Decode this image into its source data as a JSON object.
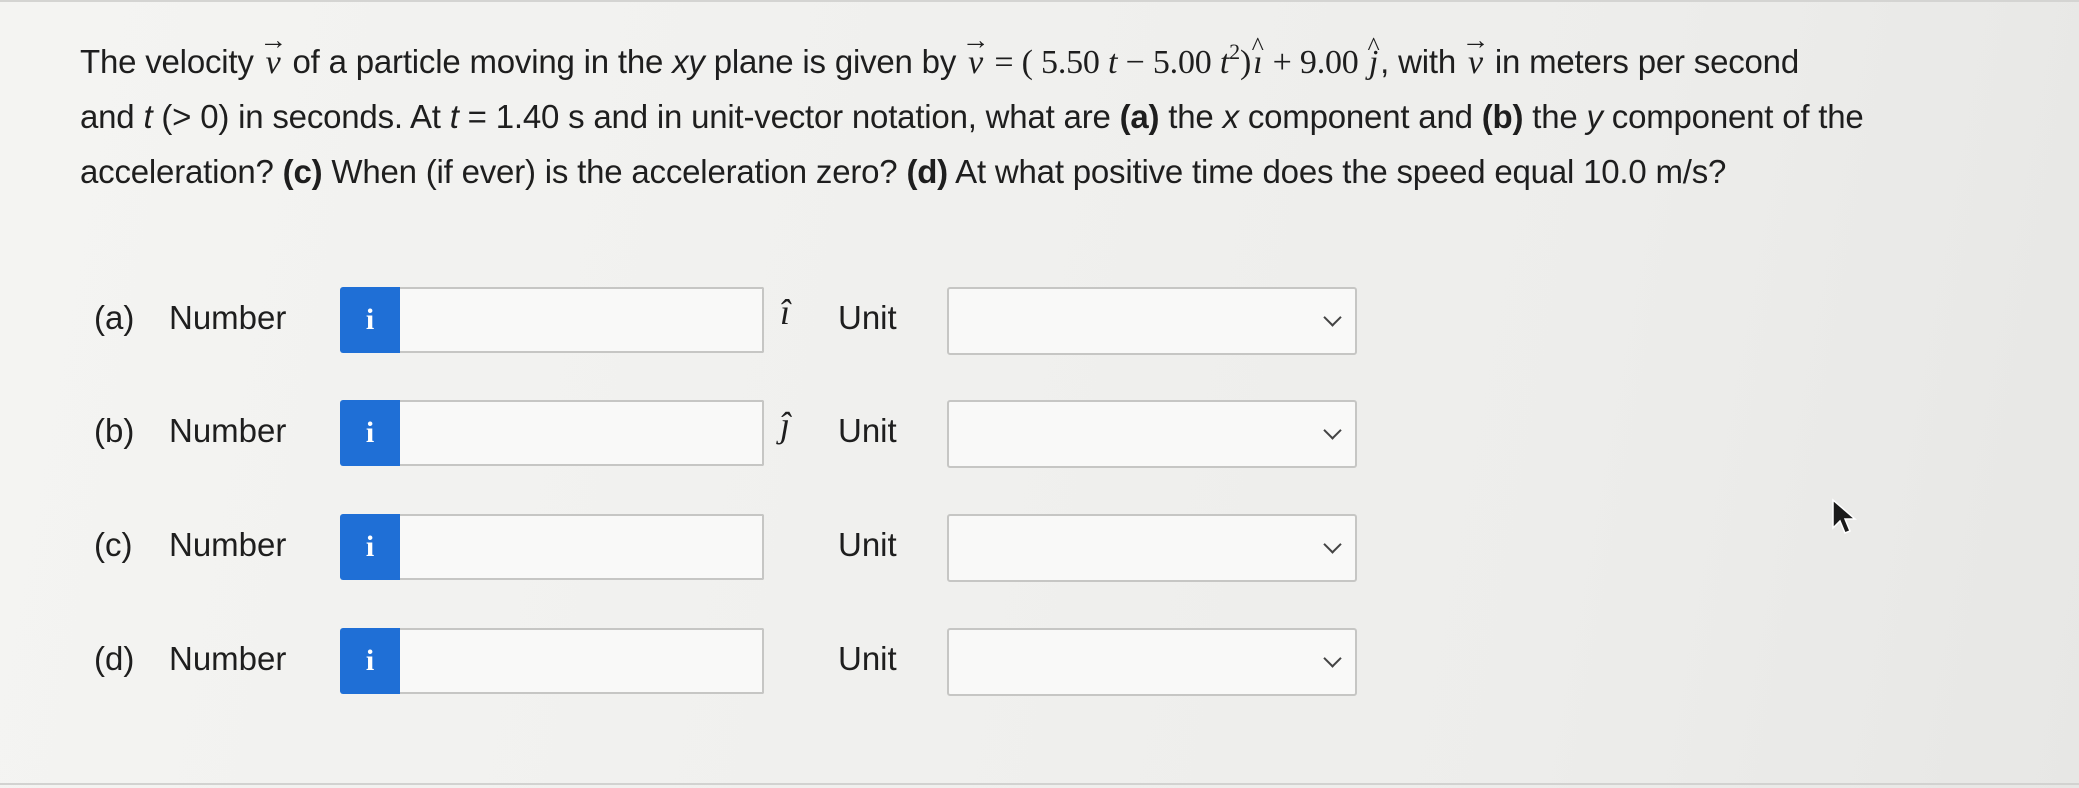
{
  "question": {
    "l1_a": "The velocity ",
    "l1_b": " of a particle moving in the ",
    "l1_xy": "xy",
    "l1_c": " plane is given by ",
    "eq_eq": " = ( ",
    "eq_c1": "5.50",
    "eq_t1": "t",
    "eq_minus": " − ",
    "eq_c2": "5.00",
    "eq_t2": "t",
    "eq_exp": "2",
    "eq_close": ")",
    "eq_plus": " + ",
    "eq_c3": "9.00",
    "l1_d": ", with ",
    "l1_e": " in meters per second",
    "l2_a": "and ",
    "l2_t": "t",
    "l2_b": " (> 0) in seconds. At ",
    "l2_t2": "t",
    "l2_c": " = 1.40 s and in unit-vector notation, what are ",
    "l2_pa": "(a)",
    "l2_d": " the ",
    "l2_x": "x",
    "l2_e": " component and ",
    "l2_pb": "(b)",
    "l2_f": " the ",
    "l2_y": "y",
    "l2_g": " component of the",
    "l3_a": "acceleration? ",
    "l3_pc": "(c)",
    "l3_b": " When (if ever) is the acceleration zero? ",
    "l3_pd": "(d)",
    "l3_c": " At what positive time does the speed equal 10.0 m/s?",
    "v_symbol": "v",
    "i_symbol": "ı",
    "j_symbol": "j"
  },
  "rows": [
    {
      "part": "(a)",
      "number_label": "Number",
      "info_label": "i",
      "unit_vector": "î",
      "unit_label": "Unit",
      "value": "",
      "unit_value": ""
    },
    {
      "part": "(b)",
      "number_label": "Number",
      "info_label": "i",
      "unit_vector": "ĵ",
      "unit_label": "Unit",
      "value": "",
      "unit_value": ""
    },
    {
      "part": "(c)",
      "number_label": "Number",
      "info_label": "i",
      "unit_vector": "",
      "unit_label": "Unit",
      "value": "",
      "unit_value": ""
    },
    {
      "part": "(d)",
      "number_label": "Number",
      "info_label": "i",
      "unit_vector": "",
      "unit_label": "Unit",
      "value": "",
      "unit_value": ""
    }
  ],
  "colors": {
    "info_button": "#1f6fd6",
    "background": "#f0f0ee",
    "text": "#1e1e1e"
  },
  "icons": {
    "info": "info-icon",
    "dropdown": "chevron-down-icon",
    "cursor": "mouse-pointer-icon"
  }
}
